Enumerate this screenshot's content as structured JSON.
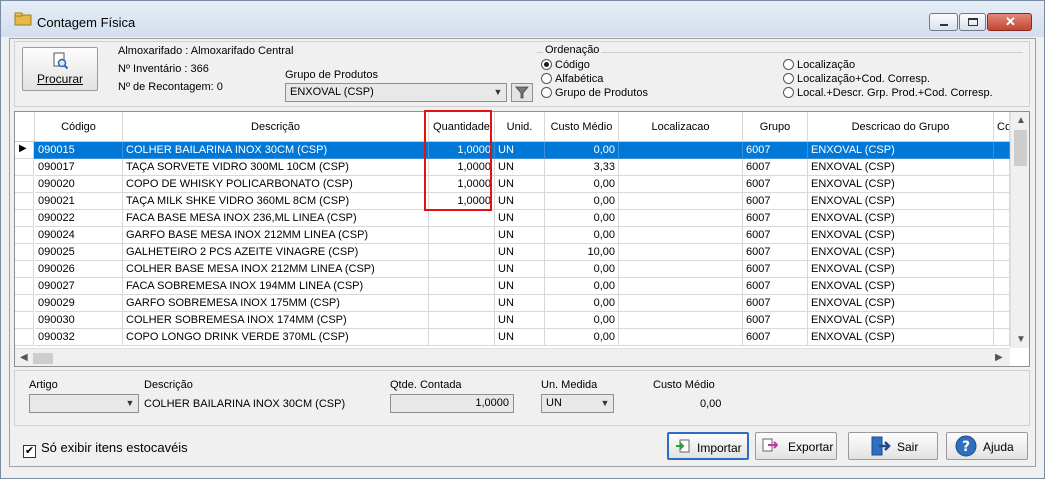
{
  "window": {
    "title": "Contagem Física",
    "accent": "#0078d7"
  },
  "top": {
    "procurar_label": "Procurar",
    "almoxarifado": "Almoxarifado : Almoxarifado Central",
    "inventario": "Nº Inventário : 366",
    "recontagem": "Nº de Recontagem: 0",
    "grupo_label": "Grupo de Produtos",
    "grupo_value": "ENXOVAL (CSP)",
    "ordenacao_title": "Ordenação",
    "ordenacao": [
      {
        "label": "Código",
        "checked": true
      },
      {
        "label": "Alfabética",
        "checked": false
      },
      {
        "label": "Grupo de Produtos",
        "checked": false
      },
      {
        "label": "Localização",
        "checked": false
      },
      {
        "label": "Localização+Cod. Corresp.",
        "checked": false
      },
      {
        "label": "Local.+Descr. Grp. Prod.+Cod. Corresp.",
        "checked": false
      }
    ]
  },
  "grid": {
    "columns": [
      "Código",
      "Descrição",
      "Quantidade",
      "Unid.",
      "Custo Médio",
      "Localizacao",
      "Grupo",
      "Descricao do Grupo",
      "Co"
    ],
    "rows": [
      [
        "090015",
        "COLHER BAILARINA INOX 30CM (CSP)",
        "1,0000",
        "UN",
        "0,00",
        "",
        "6007",
        "ENXOVAL (CSP)"
      ],
      [
        "090017",
        "TAÇA SORVETE VIDRO 300ML 10CM (CSP)",
        "1,0000",
        "UN",
        "3,33",
        "",
        "6007",
        "ENXOVAL (CSP)"
      ],
      [
        "090020",
        "COPO DE WHISKY POLICARBONATO (CSP)",
        "1,0000",
        "UN",
        "0,00",
        "",
        "6007",
        "ENXOVAL (CSP)"
      ],
      [
        "090021",
        "TAÇA MILK SHKE VIDRO 360ML 8CM (CSP)",
        "1,0000",
        "UN",
        "0,00",
        "",
        "6007",
        "ENXOVAL (CSP)"
      ],
      [
        "090022",
        "FACA BASE MESA INOX 236,ML LINEA (CSP)",
        "",
        "UN",
        "0,00",
        "",
        "6007",
        "ENXOVAL (CSP)"
      ],
      [
        "090024",
        "GARFO BASE MESA INOX 212MM LINEA (CSP)",
        "",
        "UN",
        "0,00",
        "",
        "6007",
        "ENXOVAL (CSP)"
      ],
      [
        "090025",
        "GALHETEIRO 2 PCS AZEITE VINAGRE (CSP)",
        "",
        "UN",
        "10,00",
        "",
        "6007",
        "ENXOVAL (CSP)"
      ],
      [
        "090026",
        "COLHER BASE MESA INOX 212MM LINEA (CSP)",
        "",
        "UN",
        "0,00",
        "",
        "6007",
        "ENXOVAL (CSP)"
      ],
      [
        "090027",
        "FACA SOBREMESA INOX 194MM LINEA (CSP)",
        "",
        "UN",
        "0,00",
        "",
        "6007",
        "ENXOVAL (CSP)"
      ],
      [
        "090029",
        "GARFO SOBREMESA INOX 175MM (CSP)",
        "",
        "UN",
        "0,00",
        "",
        "6007",
        "ENXOVAL (CSP)"
      ],
      [
        "090030",
        "COLHER SOBREMESA INOX 174MM (CSP)",
        "",
        "UN",
        "0,00",
        "",
        "6007",
        "ENXOVAL (CSP)"
      ],
      [
        "090032",
        "COPO LONGO DRINK VERDE 370ML (CSP)",
        "",
        "UN",
        "0,00",
        "",
        "6007",
        "ENXOVAL (CSP)"
      ]
    ],
    "selected_row": 0
  },
  "detail": {
    "artigo_label": "Artigo",
    "artigo_value": "",
    "descricao_label": "Descrição",
    "descricao_value": "COLHER BAILARINA INOX 30CM (CSP)",
    "qtde_label": "Qtde. Contada",
    "qtde_value": "1,0000",
    "unidade_label": "Un. Medida",
    "unidade_value": "UN",
    "custo_label": "Custo Médio",
    "custo_value": "0,00"
  },
  "footer": {
    "estocaveis_label": "Só exibir itens estocavéis",
    "estocaveis_checked": true,
    "importar": "Importar",
    "exportar": "Exportar",
    "sair": "Sair",
    "ajuda": "Ajuda"
  }
}
